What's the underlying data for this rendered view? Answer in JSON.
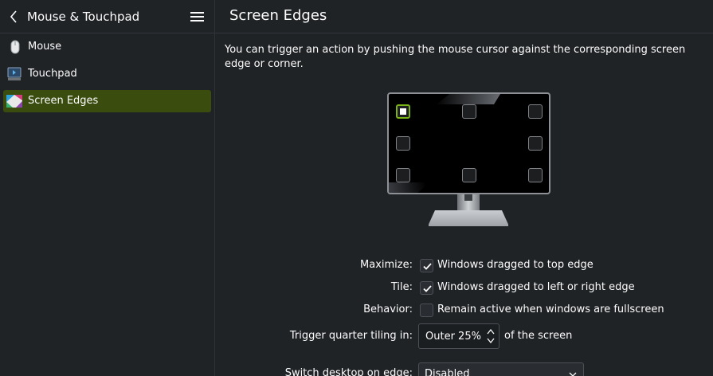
{
  "sidebar": {
    "title": "Mouse & Touchpad",
    "items": [
      {
        "label": "Mouse",
        "icon": "mouse-icon"
      },
      {
        "label": "Touchpad",
        "icon": "touchpad-icon"
      },
      {
        "label": "Screen Edges",
        "icon": "screen-edges-icon",
        "active": true
      }
    ]
  },
  "main": {
    "title": "Screen Edges",
    "intro": "You can trigger an action by pushing the mouse cursor against the corresponding screen edge or corner."
  },
  "form": {
    "maximize_label": "Maximize:",
    "maximize_option": "Windows dragged to top edge",
    "maximize_checked": true,
    "tile_label": "Tile:",
    "tile_option": "Windows dragged to left or right edge",
    "tile_checked": true,
    "behavior_label": "Behavior:",
    "behavior_option": "Remain active when windows are fullscreen",
    "behavior_checked": false,
    "quarter_label": "Trigger quarter tiling in:",
    "quarter_value": "Outer 25%",
    "quarter_suffix": "of the screen",
    "switch_label": "Switch desktop on edge:",
    "switch_value": "Disabled"
  },
  "colors": {
    "accent": "#7ab317",
    "selection": "#3a4d0f",
    "background": "#202326"
  }
}
